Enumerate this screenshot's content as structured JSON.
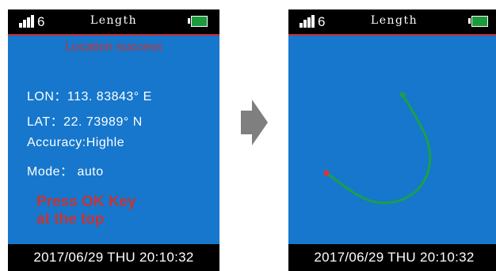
{
  "status_bar": {
    "signal_icon": "signal-bars-icon",
    "signal_count": "6",
    "title": "Length",
    "battery_icon": "battery-icon",
    "battery_color": "#1a9a3a"
  },
  "location": {
    "title": "Location success",
    "lon_label": "LON：",
    "lon_value": "113. 83843° E",
    "lat_label": "LAT：",
    "lat_value": "22. 73989° N",
    "accuracy": "Accuracy:Highle",
    "mode": "Mode： auto",
    "press_line1": "Press  OK  Key",
    "press_line2": "at the top"
  },
  "arrow_icon": "right-arrow-icon",
  "track": {
    "start_point_color": "#e53030",
    "end_point_color": "#1aa04a",
    "path_color": "#1aa04a"
  },
  "footer": {
    "datetime": "2017/06/29  THU  20:10:32"
  },
  "colors": {
    "screen_bg": "#1677cd",
    "accent_red": "#c53535",
    "bar_black": "#000000"
  }
}
